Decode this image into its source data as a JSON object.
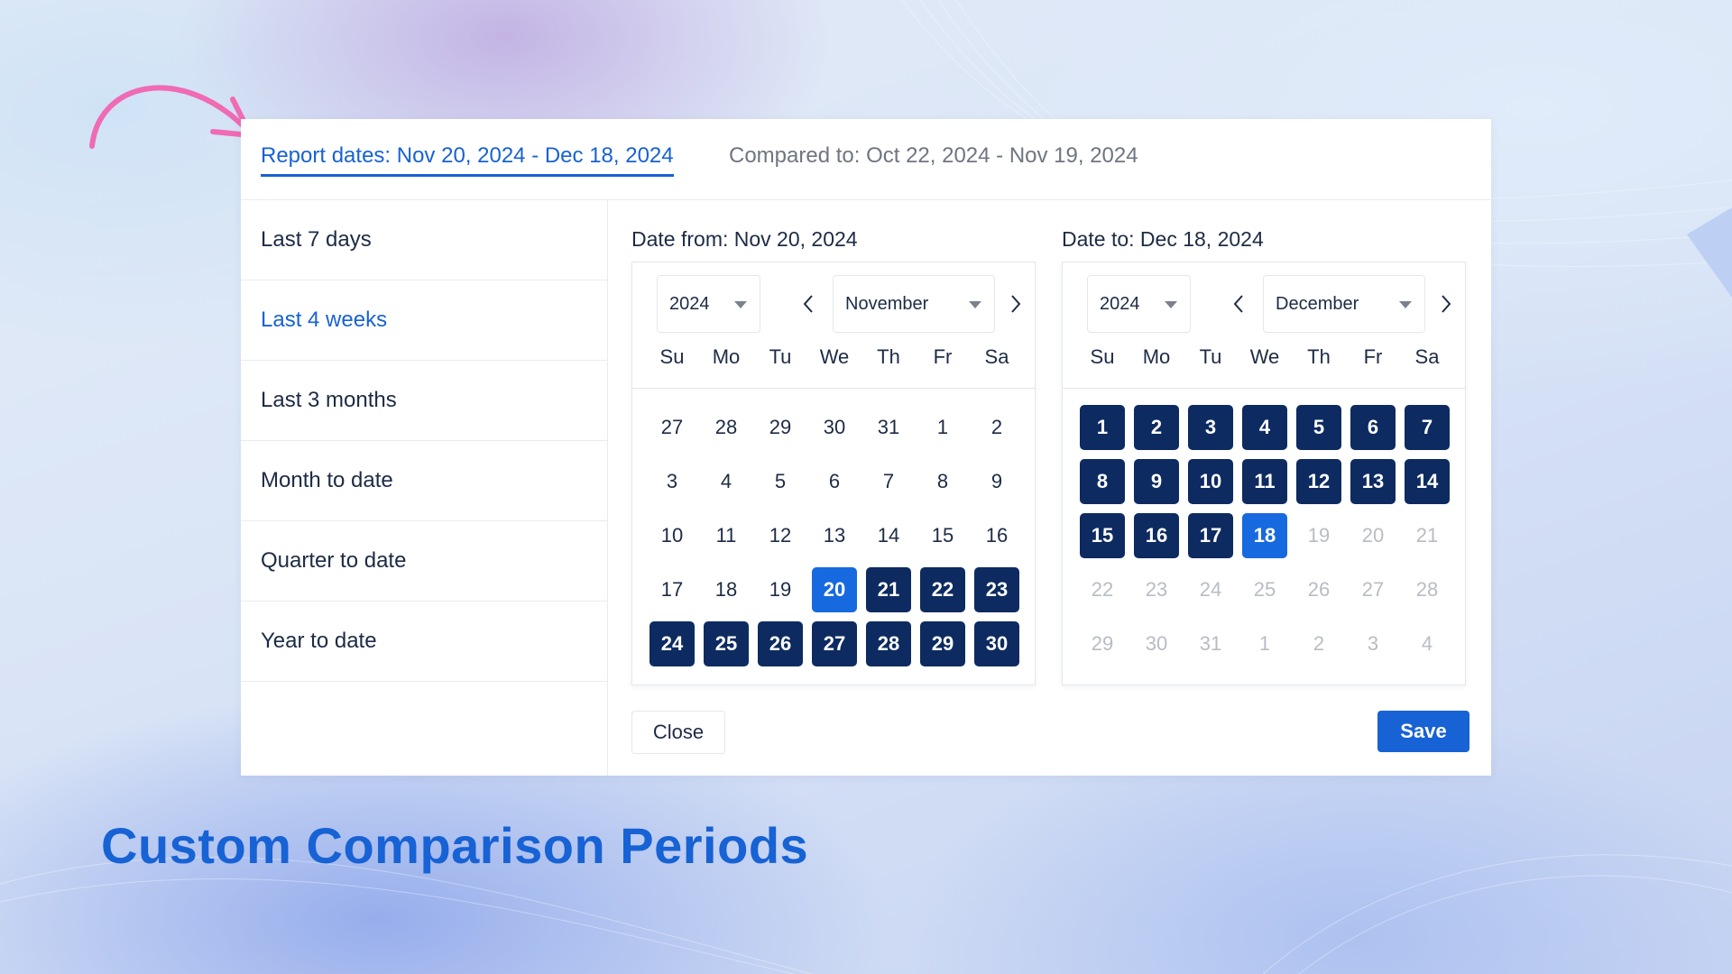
{
  "colors": {
    "accent": "#1762d4",
    "selected_range": "#0d2b61",
    "range_anchor": "#1769e0",
    "text": "#1d2b45",
    "muted": "#b8bcc4",
    "arrow": "#f06ab4"
  },
  "header": {
    "report_tab": "Report dates: Nov 20, 2024 - Dec 18, 2024",
    "compare_tab": "Compared to: Oct 22, 2024 - Nov 19, 2024"
  },
  "presets": [
    {
      "label": "Last 7 days",
      "active": false
    },
    {
      "label": "Last 4 weeks",
      "active": true
    },
    {
      "label": "Last 3 months",
      "active": false
    },
    {
      "label": "Month to date",
      "active": false
    },
    {
      "label": "Quarter to date",
      "active": false
    },
    {
      "label": "Year to date",
      "active": false
    }
  ],
  "weekdays": [
    "Su",
    "Mo",
    "Tu",
    "We",
    "Th",
    "Fr",
    "Sa"
  ],
  "from": {
    "title": "Date from: Nov 20, 2024",
    "year": "2024",
    "month": "November",
    "days": [
      {
        "d": "27",
        "s": "n"
      },
      {
        "d": "28",
        "s": "n"
      },
      {
        "d": "29",
        "s": "n"
      },
      {
        "d": "30",
        "s": "n"
      },
      {
        "d": "31",
        "s": "n"
      },
      {
        "d": "1",
        "s": "n"
      },
      {
        "d": "2",
        "s": "n"
      },
      {
        "d": "3",
        "s": "n"
      },
      {
        "d": "4",
        "s": "n"
      },
      {
        "d": "5",
        "s": "n"
      },
      {
        "d": "6",
        "s": "n"
      },
      {
        "d": "7",
        "s": "n"
      },
      {
        "d": "8",
        "s": "n"
      },
      {
        "d": "9",
        "s": "n"
      },
      {
        "d": "10",
        "s": "n"
      },
      {
        "d": "11",
        "s": "n"
      },
      {
        "d": "12",
        "s": "n"
      },
      {
        "d": "13",
        "s": "n"
      },
      {
        "d": "14",
        "s": "n"
      },
      {
        "d": "15",
        "s": "n"
      },
      {
        "d": "16",
        "s": "n"
      },
      {
        "d": "17",
        "s": "n"
      },
      {
        "d": "18",
        "s": "n"
      },
      {
        "d": "19",
        "s": "n"
      },
      {
        "d": "20",
        "s": "a"
      },
      {
        "d": "21",
        "s": "s"
      },
      {
        "d": "22",
        "s": "s"
      },
      {
        "d": "23",
        "s": "s"
      },
      {
        "d": "24",
        "s": "s"
      },
      {
        "d": "25",
        "s": "s"
      },
      {
        "d": "26",
        "s": "s"
      },
      {
        "d": "27",
        "s": "s"
      },
      {
        "d": "28",
        "s": "s"
      },
      {
        "d": "29",
        "s": "s"
      },
      {
        "d": "30",
        "s": "s"
      }
    ]
  },
  "to": {
    "title": "Date to: Dec 18, 2024",
    "year": "2024",
    "month": "December",
    "days": [
      {
        "d": "1",
        "s": "s"
      },
      {
        "d": "2",
        "s": "s"
      },
      {
        "d": "3",
        "s": "s"
      },
      {
        "d": "4",
        "s": "s"
      },
      {
        "d": "5",
        "s": "s"
      },
      {
        "d": "6",
        "s": "s"
      },
      {
        "d": "7",
        "s": "s"
      },
      {
        "d": "8",
        "s": "s"
      },
      {
        "d": "9",
        "s": "s"
      },
      {
        "d": "10",
        "s": "s"
      },
      {
        "d": "11",
        "s": "s"
      },
      {
        "d": "12",
        "s": "s"
      },
      {
        "d": "13",
        "s": "s"
      },
      {
        "d": "14",
        "s": "s"
      },
      {
        "d": "15",
        "s": "s"
      },
      {
        "d": "16",
        "s": "s"
      },
      {
        "d": "17",
        "s": "s"
      },
      {
        "d": "18",
        "s": "a"
      },
      {
        "d": "19",
        "s": "m"
      },
      {
        "d": "20",
        "s": "m"
      },
      {
        "d": "21",
        "s": "m"
      },
      {
        "d": "22",
        "s": "m"
      },
      {
        "d": "23",
        "s": "m"
      },
      {
        "d": "24",
        "s": "m"
      },
      {
        "d": "25",
        "s": "m"
      },
      {
        "d": "26",
        "s": "m"
      },
      {
        "d": "27",
        "s": "m"
      },
      {
        "d": "28",
        "s": "m"
      },
      {
        "d": "29",
        "s": "m"
      },
      {
        "d": "30",
        "s": "m"
      },
      {
        "d": "31",
        "s": "m"
      },
      {
        "d": "1",
        "s": "m"
      },
      {
        "d": "2",
        "s": "m"
      },
      {
        "d": "3",
        "s": "m"
      },
      {
        "d": "4",
        "s": "m"
      }
    ]
  },
  "buttons": {
    "close": "Close",
    "save": "Save"
  },
  "headline": "Custom Comparison Periods",
  "icons": {
    "arrow": "curved-arrow-icon",
    "prev": "chevron-left-icon",
    "next": "chevron-right-icon",
    "caret": "caret-down-icon"
  }
}
